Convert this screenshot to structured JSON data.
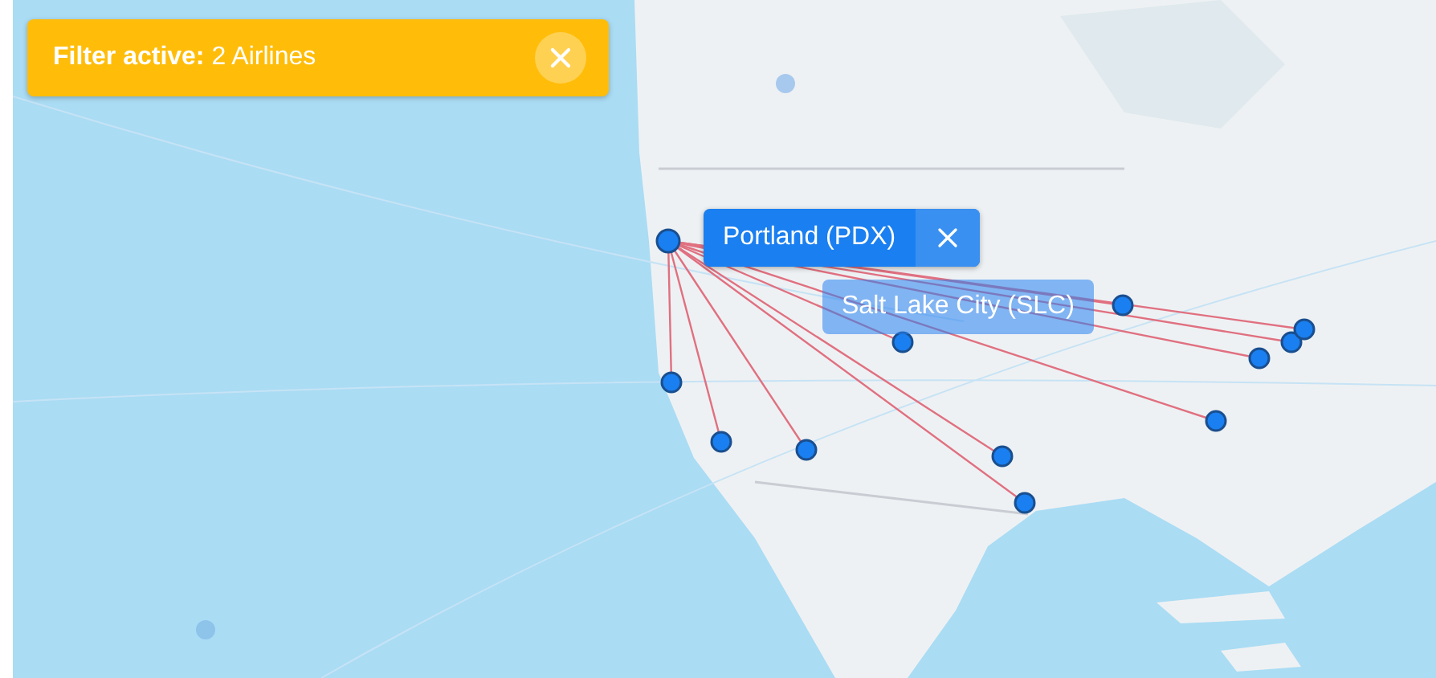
{
  "filter_banner": {
    "label": "Filter active:",
    "value": "2 Airlines"
  },
  "selected_airport": {
    "label": "Portland (PDX)"
  },
  "hovered_airport": {
    "label": "Salt Lake City (SLC)"
  }
}
